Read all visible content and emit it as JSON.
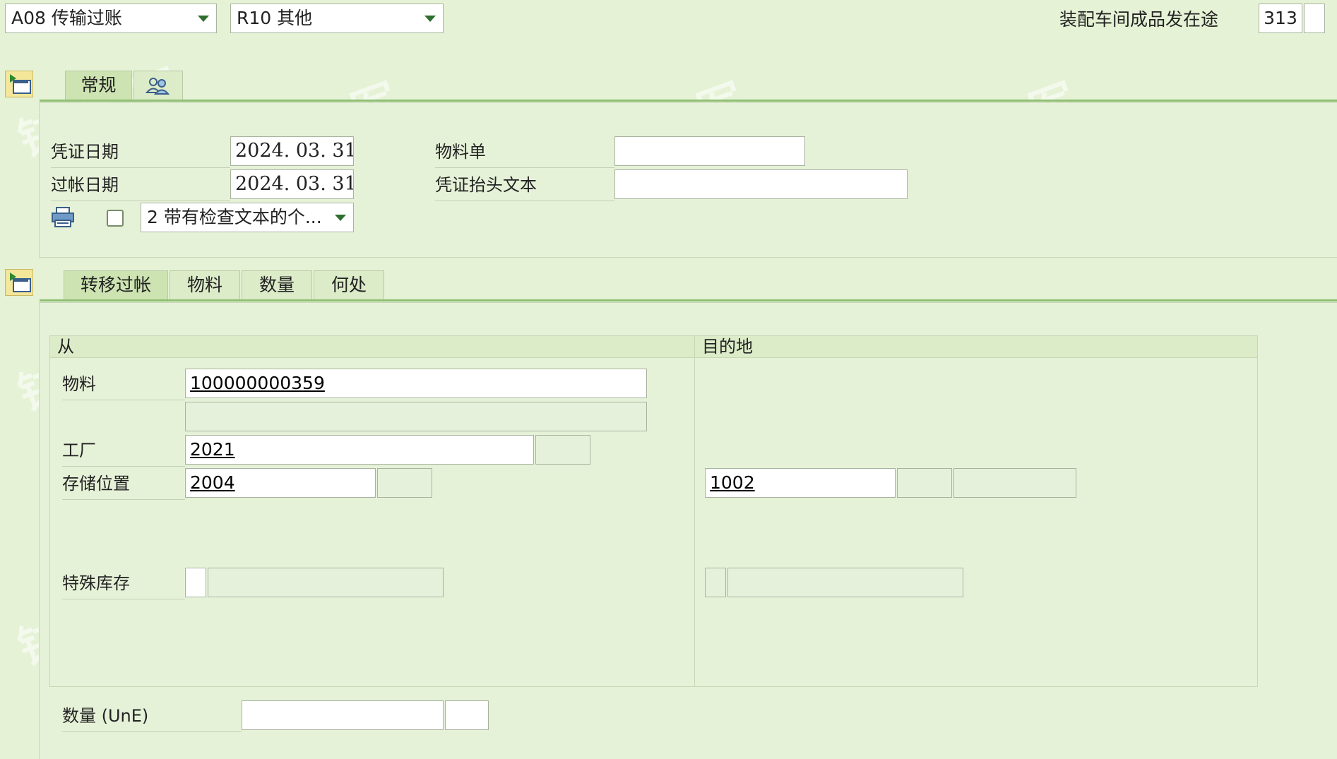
{
  "header": {
    "movement_type": "A08 传输过账",
    "reason": "R10 其他",
    "mvt_desc": "装配车间成品发在途",
    "mvt_code": "313"
  },
  "general_tab": {
    "tab_label": "常规",
    "doc_date_label": "凭证日期",
    "doc_date": "2024. 03. 31",
    "post_date_label": "过帐日期",
    "post_date": "2024. 03. 31",
    "bill_of_lading_label": "物料单",
    "bill_of_lading": "",
    "header_text_label": "凭证抬头文本",
    "header_text": "",
    "print_option": "2 带有检查文本的个..."
  },
  "item_tabs": [
    "转移过帐",
    "物料",
    "数量",
    "何处"
  ],
  "transfer": {
    "from_label": "从",
    "to_label": "目的地",
    "material_label": "物料",
    "material": "100000000359",
    "plant_label": "工厂",
    "plant": "2021",
    "sloc_label": "存储位置",
    "sloc_from": "2004",
    "sloc_to": "1002",
    "special_stock_label": "特殊库存",
    "qty_label": "数量 (UnE)"
  },
  "watermark_text": "铱 将 军"
}
